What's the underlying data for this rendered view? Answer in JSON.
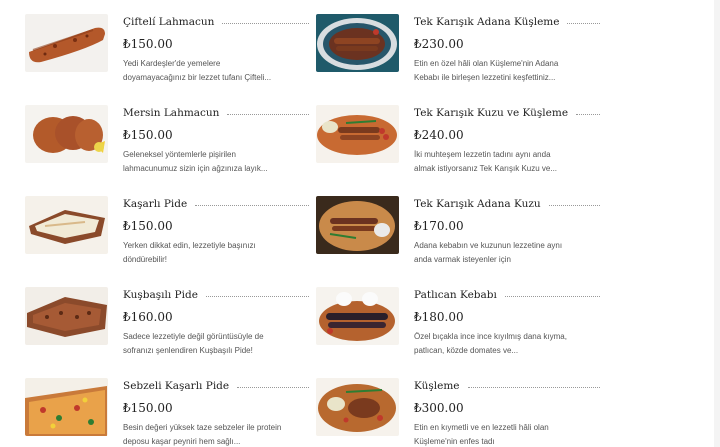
{
  "colors": {
    "text": "#222222",
    "muted": "#555555",
    "leader": "#999999",
    "background": "#ffffff"
  },
  "currency": "₺",
  "left_items": [
    {
      "name": "Çiftelí Lahmacun",
      "price": "₺150.00",
      "desc": "Yedi Kardeşler'de yemelere doyamayacağınız bir lezzet tufanı Çifteli...",
      "image": "lahmacun-double"
    },
    {
      "name": "Mersin Lahmacun",
      "price": "₺150.00",
      "desc": "Geleneksel yöntemlerle pişirilen lahmacunumuz sizin için ağzınıza layık...",
      "image": "lahmacun-lemon"
    },
    {
      "name": "Kaşarlı Pide",
      "price": "₺150.00",
      "desc": "Yerken dikkat edin, lezzetiyle başınızı döndürebilir!",
      "image": "pide-cheese"
    },
    {
      "name": "Kuşbaşılı Pide",
      "price": "₺160.00",
      "desc": "Sadece lezzetiyle değil görüntüsüyle de sofranızı şenlendiren Kuşbaşılı Pide!",
      "image": "pide-meat"
    },
    {
      "name": "Sebzeli Kaşarlı Pide",
      "price": "₺150.00",
      "desc": "Besin değeri yüksek taze sebzeler ile protein deposu kaşar peyniri hem sağlı...",
      "image": "pide-veg"
    }
  ],
  "right_items": [
    {
      "name": "Tek Karışık Adana Küşleme",
      "price": "₺230.00",
      "desc": "Etin en özel hâli olan Küşleme'nin Adana Kebabı ile birleşen lezzetini keşfettiniz...",
      "image": "plate-blue"
    },
    {
      "name": "Tek Karışık Kuzu ve Küşleme",
      "price": "₺240.00",
      "desc": "İki muhteşem lezzetin tadını aynı anda almak istiyorsanız Tek Karışık Kuzu ve...",
      "image": "plate-kebab"
    },
    {
      "name": "Tek Karışık Adana Kuzu",
      "price": "₺170.00",
      "desc": "Adana kebabın ve kuzunun lezzetine aynı anda varmak isteyenler için",
      "image": "plate-wood"
    },
    {
      "name": "Patlıcan Kebabı",
      "price": "₺180.00",
      "desc": "Özel bıçakla ince ince kıyılmış dana kıyma, patlıcan, közde domates ve...",
      "image": "plate-eggplant"
    },
    {
      "name": "Küşleme",
      "price": "₺300.00",
      "desc": "Etin en kıymetli ve en lezzetli hâli olan Küşleme'nin enfes tadı",
      "image": "plate-kusleme"
    }
  ]
}
